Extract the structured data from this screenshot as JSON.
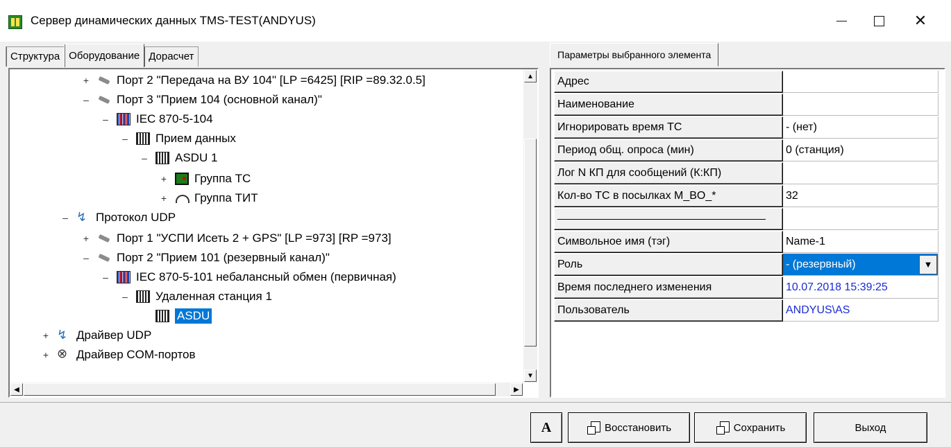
{
  "window": {
    "title": "Сервер динамических данных TMS-TEST(ANDYUS)",
    "controls": {
      "minimize": "—",
      "maximize": "☐",
      "close": "✕"
    }
  },
  "left_tabs": [
    "Структура",
    "Оборудование",
    "Дорасчет"
  ],
  "left_active_tab": "Оборудование",
  "tree": [
    {
      "label": "Порт  2 \"Передача на ВУ 104\" [LP =6425] [RIP =89.32.0.5]",
      "expander": "+",
      "icon": "port-icon"
    },
    {
      "label": "Порт  3 \"Прием 104 (основной канал)\"",
      "expander": "–",
      "icon": "port-icon"
    },
    {
      "label": "IEC 870-5-104",
      "expander": "–",
      "icon": "iec-icon"
    },
    {
      "label": "Прием данных",
      "expander": "–",
      "icon": "iec-bw-icon"
    },
    {
      "label": "ASDU  1",
      "expander": "–",
      "icon": "iec-bw-icon"
    },
    {
      "label": "Группа ТС",
      "expander": "+",
      "icon": "ts-group-icon"
    },
    {
      "label": "Группа ТИТ",
      "expander": "+",
      "icon": "tit-group-icon"
    },
    {
      "label": "Протокол UDP",
      "expander": "–",
      "icon": "udp-protocol-icon"
    },
    {
      "label": "Порт  1 \"УСПИ Исеть 2 + GPS\" [LP =973] [RP =973]",
      "expander": "+",
      "icon": "port-icon"
    },
    {
      "label": "Порт  2 \"Прием 101 (резервный канал)\"",
      "expander": "–",
      "icon": "port-icon"
    },
    {
      "label": "IEC 870-5-101 небалансный обмен (первичная)",
      "expander": "–",
      "icon": "iec-icon"
    },
    {
      "label": "Удаленная станция  1",
      "expander": "–",
      "icon": "iec-bw-icon"
    },
    {
      "label": "ASDU",
      "expander": "",
      "icon": "iec-bw-icon",
      "selected": true
    },
    {
      "label": "Драйвер UDP",
      "expander": "+",
      "icon": "udp-driver-icon"
    },
    {
      "label": "Драйвер COM-портов",
      "expander": "+",
      "icon": "com-driver-icon"
    }
  ],
  "right_tab": "Параметры выбранного элемента",
  "properties": [
    {
      "name": "Адрес",
      "value": ""
    },
    {
      "name": "Наименование",
      "value": ""
    },
    {
      "name": "Игнорировать время ТС",
      "value": "- (нет)"
    },
    {
      "name": "Период общ. опроса (мин)",
      "value": "0 (станция)"
    },
    {
      "name": "Лог N КП для сообщений (К:КП)",
      "value": ""
    },
    {
      "name": "Кол-во ТС в посылках M_BO_*",
      "value": "32"
    },
    {
      "name": "",
      "value": "",
      "separator": true
    },
    {
      "name": "Символьное имя (тэг)",
      "value": "Name-1"
    },
    {
      "name": "Роль",
      "value": "- (резервный)",
      "selected": true
    },
    {
      "name": "Время последнего изменения",
      "value": "10.07.2018 15:39:25",
      "blue": true
    },
    {
      "name": "Пользователь",
      "value": "ANDYUS\\AS",
      "blue": true
    }
  ],
  "buttons": {
    "font": "A",
    "restore": "Восстановить",
    "save": "Сохранить",
    "exit": "Выход"
  },
  "colors": {
    "selection": "#0078d7",
    "link_blue": "#1a2ad6",
    "app_icon": "#2a8a2a"
  }
}
